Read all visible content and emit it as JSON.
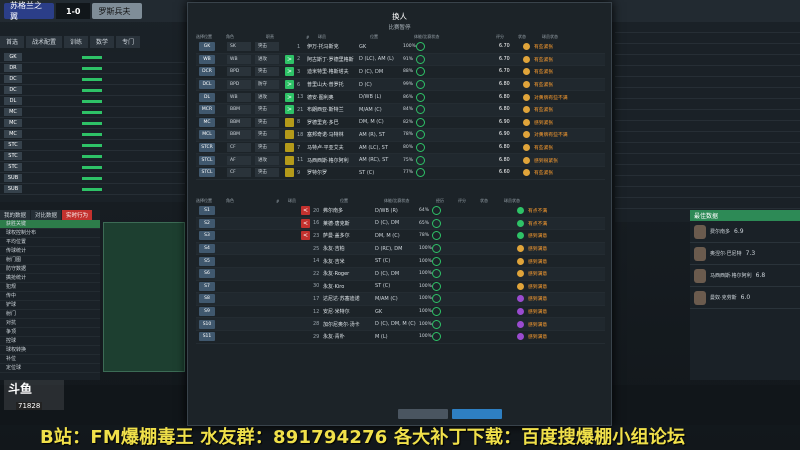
{
  "topbar": {
    "home_team": "苏格兰之翼",
    "score": "1-0",
    "away_team": "罗斯兵夫"
  },
  "left_tabs": [
    "首选",
    "战术配置",
    "训练",
    "数学",
    "专门"
  ],
  "left_bottom_tabs": [
    "我的数据",
    "对比数据",
    "实时行为"
  ],
  "left_bottom_items": [
    "获胜关键",
    "球权控制分布",
    "平均位置",
    "传球统计",
    "射门图",
    "防守数据",
    "擒抢统计",
    "犯规",
    "传中",
    "铲球",
    "射门",
    "对抗",
    "争顶",
    "控球",
    "球权转换",
    "补位",
    "定位球"
  ],
  "modal": {
    "title": "换人",
    "subtitle": "比赛暂停",
    "headers_top": [
      "选择位置",
      "角色",
      "职责",
      "",
      "#",
      "球员",
      "位置",
      "体能/比赛状态",
      "",
      "评分",
      "",
      "",
      "状态",
      "球员状态"
    ],
    "headers_bottom": [
      "选择位置",
      "角色",
      "#",
      "球员",
      "位置",
      "体能/比赛状态",
      "经历",
      "评分",
      "状态",
      "球员状态"
    ],
    "starters": [
      {
        "pos": "GK",
        "role": "SK",
        "duty": "突击",
        "sw": "",
        "num": "1",
        "name": "伊万·托马斯克",
        "p": "GK",
        "cond": "100%",
        "rating": "6.70",
        "dot": "#e0a43a",
        "status": "有些紧张"
      },
      {
        "pos": "WB",
        "role": "WB",
        "duty": "进攻",
        "sw": ">",
        "num": "2",
        "name": "阿古斯丁·罗德里格斯",
        "p": "D (LC), AM (L)",
        "cond": "91%",
        "rating": "6.70",
        "dot": "#e0a43a",
        "status": "有些紧张"
      },
      {
        "pos": "DCR",
        "role": "BPD",
        "duty": "突击",
        "sw": ">",
        "num": "3",
        "name": "迪米特里·格斯塔夫",
        "p": "D (C), DM",
        "cond": "88%",
        "rating": "6.70",
        "dot": "#e0a43a",
        "status": "有些紧张"
      },
      {
        "pos": "DCL",
        "role": "BPD",
        "duty": "防守",
        "sw": ">",
        "num": "6",
        "name": "普里山大·普罗托",
        "p": "D (C)",
        "cond": "99%",
        "rating": "6.80",
        "dot": "#e0a43a",
        "status": "有些紧张"
      },
      {
        "pos": "DL",
        "role": "WB",
        "duty": "进攻",
        "sw": ">",
        "num": "13",
        "name": "德安·图利奥",
        "p": "D/WB (L)",
        "cond": "86%",
        "rating": "6.80",
        "dot": "#e0a43a",
        "status": "对黄牌有些不满"
      },
      {
        "pos": "MCR",
        "role": "BBM",
        "duty": "突击",
        "sw": ">",
        "num": "21",
        "name": "布朗西亚·斯特兰",
        "p": "M/AM (C)",
        "cond": "84%",
        "rating": "6.80",
        "dot": "#e0a43a",
        "status": "有些紧张"
      },
      {
        "pos": "MC",
        "role": "BBM",
        "duty": "突击",
        "sw": "",
        "num": "8",
        "name": "罗德里克·多巴",
        "p": "DM, M (C)",
        "cond": "82%",
        "rating": "6.90",
        "dot": "#e0a43a",
        "status": "感到紧张"
      },
      {
        "pos": "MCL",
        "role": "BBM",
        "duty": "突击",
        "sw": "",
        "num": "18",
        "name": "塞邦奇诺·马特林",
        "p": "AM (R), ST",
        "cond": "78%",
        "rating": "6.90",
        "dot": "#e0a43a",
        "status": "对黄牌有些不满"
      },
      {
        "pos": "STCR",
        "role": "CF",
        "duty": "突击",
        "sw": "",
        "num": "7",
        "name": "马特卢·平亚艾夫",
        "p": "AM (LC), ST",
        "cond": "80%",
        "rating": "6.80",
        "dot": "#e0a43a",
        "status": "有些紧张"
      },
      {
        "pos": "STCL",
        "role": "AF",
        "duty": "进攻",
        "sw": "",
        "num": "11",
        "name": "马西西斯·格尔阿利",
        "p": "AM (RC), ST",
        "cond": "75%",
        "rating": "6.80",
        "dot": "#e0a43a",
        "status": "感到很紧张"
      },
      {
        "pos": "STCL",
        "role": "CF",
        "duty": "突击",
        "sw": "",
        "num": "9",
        "name": "罗特尔罗",
        "p": "ST (C)",
        "cond": "77%",
        "rating": "6.60",
        "dot": "#e0a43a",
        "status": "有些紧张"
      }
    ],
    "subs": [
      {
        "pos": "S1",
        "sw": "<",
        "num": "20",
        "name": "弗尔南多",
        "p": "D/WB (R)",
        "cond": "64%",
        "dot": "#2ec267",
        "status": "有点不满"
      },
      {
        "pos": "S2",
        "sw": "<",
        "num": "16",
        "name": "莱德·唐克斯",
        "p": "D (C), DM",
        "cond": "65%",
        "dot": "#2ec267",
        "status": "有点不满"
      },
      {
        "pos": "S3",
        "sw": "<",
        "num": "23",
        "name": "萨曼·盖多尔",
        "p": "DM, M (C)",
        "cond": "78%",
        "dot": "#2ec267",
        "status": "感到满意"
      },
      {
        "pos": "S4",
        "sw": "",
        "num": "25",
        "name": "永友·吉柏",
        "p": "D (RC), DM",
        "cond": "100%",
        "dot": "#e0a43a",
        "status": "感到满意"
      },
      {
        "pos": "S5",
        "sw": "",
        "num": "14",
        "name": "永友·吉米",
        "p": "ST (C)",
        "cond": "100%",
        "dot": "#e0a43a",
        "status": "感到满意"
      },
      {
        "pos": "S6",
        "sw": "",
        "num": "22",
        "name": "永友·Roger",
        "p": "D (C), DM",
        "cond": "100%",
        "dot": "#e0a43a",
        "status": "感到满意"
      },
      {
        "pos": "S7",
        "sw": "",
        "num": "30",
        "name": "永友·Kiro",
        "p": "ST (C)",
        "cond": "100%",
        "dot": "#e0a43a",
        "status": "感到满意"
      },
      {
        "pos": "S8",
        "sw": "",
        "num": "17",
        "name": "达尼达·苏塞迪诺",
        "p": "M/AM (C)",
        "cond": "100%",
        "dot": "#9a4bcf",
        "status": "感到满意"
      },
      {
        "pos": "S9",
        "sw": "",
        "num": "12",
        "name": "安尼·米特尔",
        "p": "GK",
        "cond": "100%",
        "dot": "#9a4bcf",
        "status": "感到满意"
      },
      {
        "pos": "S10",
        "sw": "",
        "num": "28",
        "name": "加尔尼奥尔·汤卡",
        "p": "D (C), DM, M (C)",
        "cond": "100%",
        "dot": "#9a4bcf",
        "status": "感到满意"
      },
      {
        "pos": "S11",
        "sw": "",
        "num": "29",
        "name": "永友·青朴",
        "p": "M (L)",
        "cond": "100%",
        "dot": "#9a4bcf",
        "status": "感到满意"
      }
    ]
  },
  "right_bottom": {
    "header": "最佳数据",
    "cards": [
      {
        "name": "费尔南多",
        "num": "6.9"
      },
      {
        "name": "奥涅尔·巴尼特",
        "num": "7.3"
      },
      {
        "name": "马西西斯·格尔阿利",
        "num": "6.8"
      },
      {
        "name": "曼奴·克劳斯",
        "num": "6.0"
      }
    ]
  },
  "overlay": {
    "douyu": "斗鱼",
    "douyu_id": "71828",
    "banner": "B站：FM爆棚毒王 水友群：891794276 各大补丁下载：百度搜爆棚小组论坛"
  }
}
